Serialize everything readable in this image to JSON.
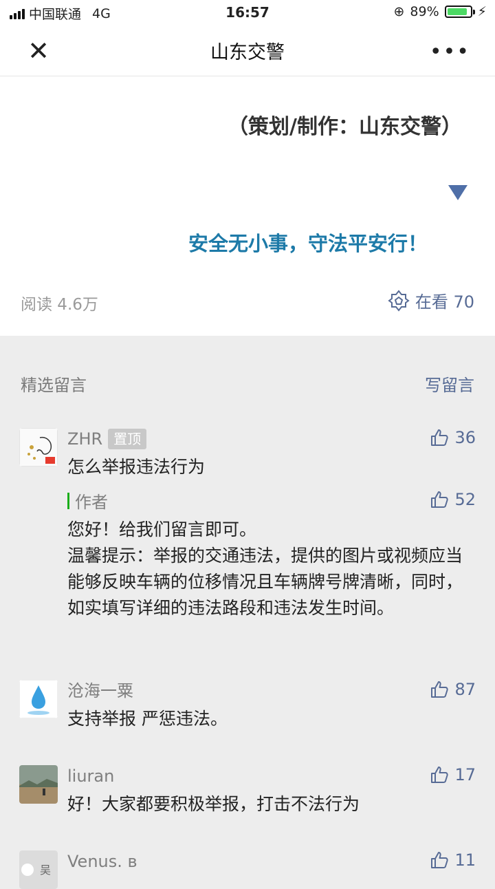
{
  "status_bar": {
    "carrier": "中国联通",
    "network": "4G",
    "time": "16:57",
    "battery_percent": "89%",
    "battery_level": 0.89
  },
  "nav": {
    "title": "山东交警"
  },
  "article": {
    "credit": "（策划/制作：山东交警）",
    "slogan": "安全无小事，守法平安行！",
    "reads": "阅读 4.6万",
    "wow_label": "在看 70"
  },
  "comments": {
    "section_label": "精选留言",
    "write_label": "写留言",
    "items": [
      {
        "nickname": "ZHR",
        "badge": "置顶",
        "likes": "36",
        "text": "怎么举报违法行为",
        "reply": {
          "label": "作者",
          "likes": "52",
          "text": "您好！给我们留言即可。\n温馨提示：举报的交通违法，提供的图片或视频应当能够反映车辆的位移情况且车辆牌号牌清晰，同时，如实填写详细的违法路段和违法发生时间。"
        }
      },
      {
        "nickname": "沧海一粟",
        "likes": "87",
        "text": "支持举报 严惩违法。"
      },
      {
        "nickname": "liuran",
        "likes": "17",
        "text": "好！大家都要积极举报，打击不法行为"
      },
      {
        "nickname": "Venus. в",
        "likes": "11",
        "text": ""
      }
    ]
  },
  "colors": {
    "link": "#576b95",
    "slogan": "#1d7aa8",
    "author_bar": "#1aad19"
  }
}
